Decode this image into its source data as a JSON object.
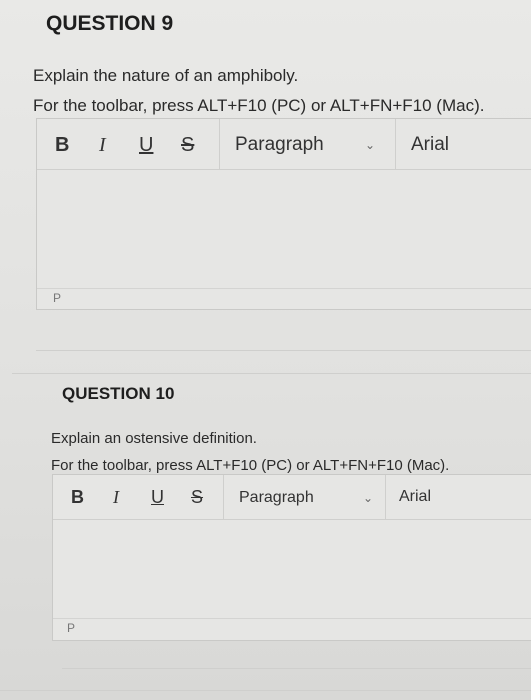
{
  "q9": {
    "title": "QUESTION 9",
    "prompt": "Explain the nature of an amphiboly.",
    "hint": "For the toolbar, press ALT+F10 (PC) or ALT+FN+F10 (Mac).",
    "toolbar": {
      "bold": "B",
      "italic": "I",
      "underline": "U",
      "strike": "S",
      "format": "Paragraph",
      "font": "Arial"
    },
    "status": "P"
  },
  "q10": {
    "title": "QUESTION 10",
    "prompt": "Explain an ostensive definition.",
    "hint": "For the toolbar, press ALT+F10 (PC) or ALT+FN+F10 (Mac).",
    "toolbar": {
      "bold": "B",
      "italic": "I",
      "underline": "U",
      "strike": "S",
      "format": "Paragraph",
      "font": "Arial"
    },
    "status": "P"
  },
  "icons": {
    "chevron": "chevron-down-icon"
  }
}
